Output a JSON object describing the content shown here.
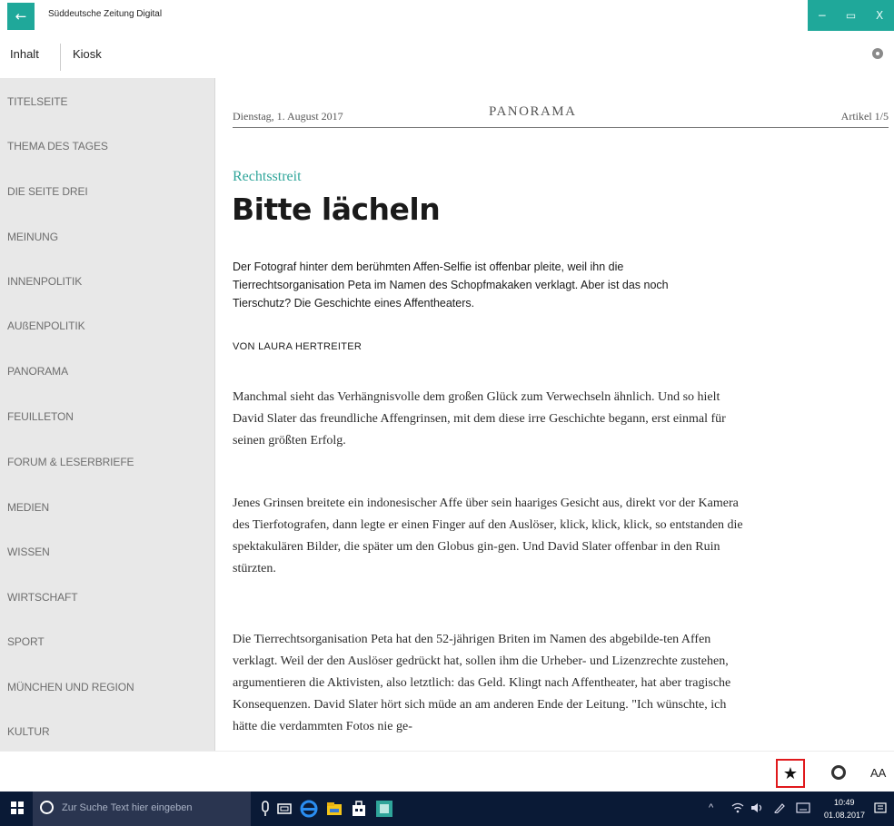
{
  "window": {
    "title": "Süddeutsche Zeitung Digital",
    "back_glyph": "←",
    "minimize_glyph": "−",
    "maximize_glyph": "▭",
    "close_glyph": "X"
  },
  "topnav": {
    "tabs": [
      "Inhalt",
      "Kiosk"
    ]
  },
  "sidebar": {
    "items": [
      "TITELSEITE",
      "THEMA DES TAGES",
      "DIE SEITE DREI",
      "MEINUNG",
      "INNENPOLITIK",
      "AUßENPOLITIK",
      "PANORAMA",
      "FEUILLETON",
      "FORUM & LESERBRIEFE",
      "MEDIEN",
      "WISSEN",
      "WIRTSCHAFT",
      "SPORT",
      "MÜNCHEN UND REGION",
      "KULTUR"
    ]
  },
  "article": {
    "date": "Dienstag, 1. August 2017",
    "section": "PANORAMA",
    "counter": "Artikel 1/5",
    "kicker": "Rechtsstreit",
    "headline": "Bitte lächeln",
    "lead": "Der Fotograf hinter dem berühmten Affen-Selfie ist offenbar pleite, weil ihn die Tierrechtsorganisation Peta im Namen des Schopfmakaken verklagt. Aber ist das noch Tierschutz? Die Geschichte eines Affentheaters.",
    "byline": "VON LAURA HERTREITER",
    "paragraphs": [
      "Manchmal sieht das Verhängnisvolle dem großen Glück zum Verwechseln ähnlich. Und so hielt David Slater das freundliche Affengrinsen, mit dem diese irre Geschichte begann, erst einmal für seinen größten Erfolg.",
      "Jenes Grinsen breitete ein indonesischer Affe über sein haariges Gesicht aus, direkt vor der Kamera des Tierfotografen, dann legte er einen Finger auf den Auslöser, klick, klick, klick, so entstanden die spektakulären Bilder, die später um den Globus gin-gen. Und David Slater offenbar in den Ruin stürzten.",
      "Die Tierrechtsorganisation Peta hat den 52-jährigen Briten im Namen des abgebilde-ten Affen verklagt. Weil der den Auslöser gedrückt hat, sollen ihm die Urheber- und Lizenzrechte zustehen, argumentieren die Aktivisten, also letztlich: das Geld. Klingt nach Affentheater, hat aber tragische Konsequenzen. David Slater hört sich müde an am anderen Ende der Leitung. \"Ich wünschte, ich hätte die verdammten Fotos nie ge-"
    ]
  },
  "appbar": {
    "star_glyph": "★",
    "font_label": "AA"
  },
  "taskbar": {
    "search_placeholder": "Zur Suche Text hier eingeben",
    "time": "10:49",
    "date": "01.08.2017"
  },
  "colors": {
    "accent": "#1fa89a",
    "highlight": "#e0191c",
    "taskbar": "#0a1a36"
  }
}
